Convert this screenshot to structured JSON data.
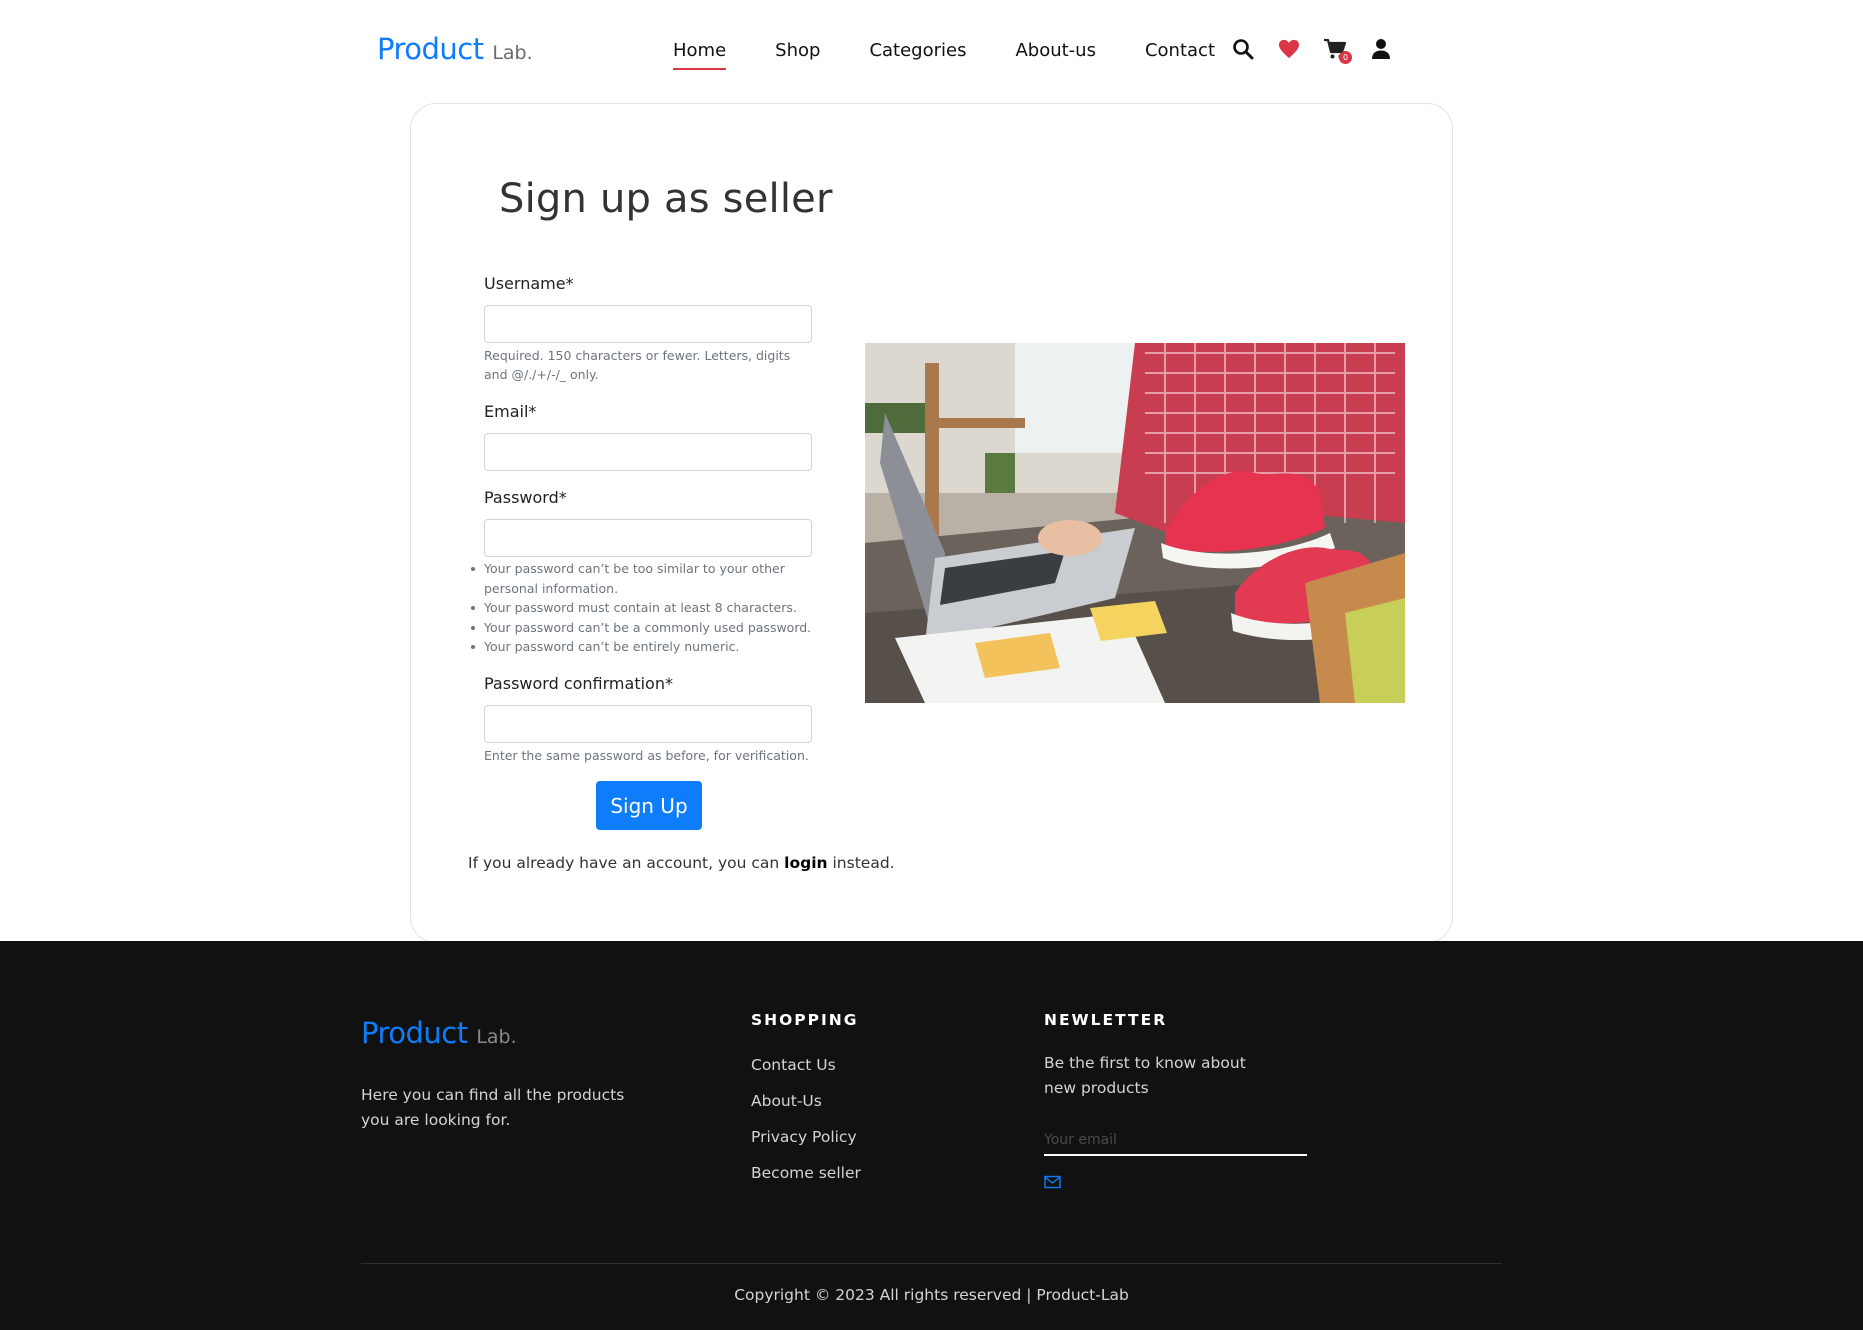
{
  "brand": {
    "name": "Product",
    "suffix": "Lab."
  },
  "nav": {
    "links": [
      "Home",
      "Shop",
      "Categories",
      "About-us",
      "Contact"
    ],
    "active": "Home",
    "cart_count": "0"
  },
  "form": {
    "title": "Sign up as seller",
    "username_label": "Username*",
    "username_help": "Required. 150 characters or fewer. Letters, digits and @/./+/-/_ only.",
    "email_label": "Email*",
    "password_label": "Password*",
    "password_rules": [
      "Your password can’t be too similar to your other personal information.",
      "Your password must contain at least 8 characters.",
      "Your password can’t be a commonly used password.",
      "Your password can’t be entirely numeric."
    ],
    "password_confirm_label": "Password confirmation*",
    "password_confirm_help": "Enter the same password as before, for verification.",
    "submit_label": "Sign Up",
    "login_prefix": "If you already have an account, you can ",
    "login_link": "login",
    "login_suffix": " instead."
  },
  "footer": {
    "description": "Here you can find all the products you are looking for.",
    "shopping_heading": "SHOPPING",
    "shopping_links": [
      "Contact Us",
      "About-Us",
      "Privacy Policy",
      "Become seller"
    ],
    "newsletter_heading": "NEWLETTER",
    "newsletter_text": "Be the first to know about new products",
    "email_placeholder": "Your email",
    "copyright": "Copyright © 2023 All rights reserved | Product-Lab"
  },
  "colors": {
    "accent": "#0d7dfb",
    "active_underline": "#dc3545",
    "footer_bg": "#111111",
    "heart": "#dc3545"
  },
  "icons": [
    "search-icon",
    "heart-icon",
    "cart-icon",
    "user-icon",
    "envelope-icon"
  ]
}
